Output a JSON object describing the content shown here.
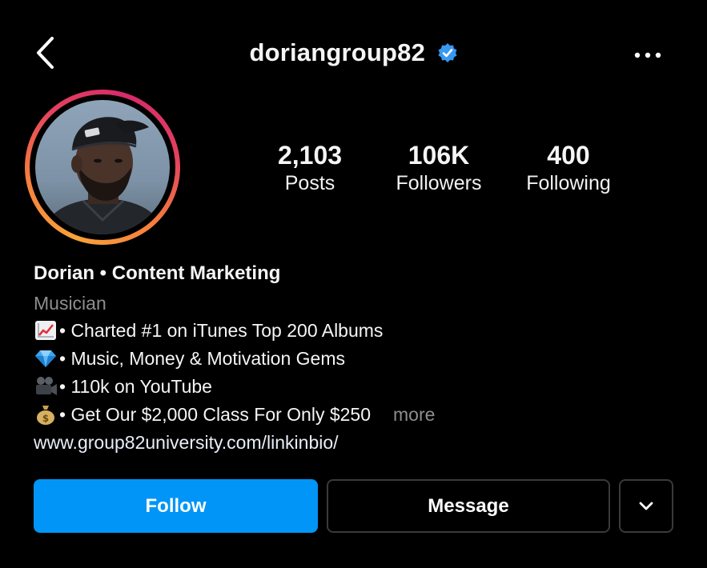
{
  "header": {
    "username": "doriangroup82",
    "verified": true,
    "back_icon": "chevron-left-icon",
    "more_icon": "more-horizontal-icon",
    "verified_color": "#3897f0"
  },
  "profile": {
    "avatar_ring_colors": [
      "#f9a23a",
      "#e4405f",
      "#d52b6b"
    ]
  },
  "stats": {
    "posts": {
      "value": "2,103",
      "label": "Posts"
    },
    "followers": {
      "value": "106K",
      "label": "Followers"
    },
    "following": {
      "value": "400",
      "label": "Following"
    }
  },
  "bio": {
    "name": "Dorian • Content Marketing",
    "category": "Musician",
    "lines": [
      {
        "icon": "chart-increasing-emoji",
        "text": "• Charted #1 on iTunes Top 200 Albums"
      },
      {
        "icon": "gem-emoji",
        "text": "• Music, Money & Motivation Gems"
      },
      {
        "icon": "movie-camera-emoji",
        "text": "• 110k on YouTube"
      },
      {
        "icon": "money-bag-emoji",
        "text": "• Get Our $2,000 Class For Only $250"
      }
    ],
    "more_label": "more",
    "link": "www.group82university.com/linkinbio/"
  },
  "actions": {
    "follow_label": "Follow",
    "message_label": "Message",
    "dropdown_icon": "chevron-down-icon",
    "follow_color": "#0095f6"
  }
}
